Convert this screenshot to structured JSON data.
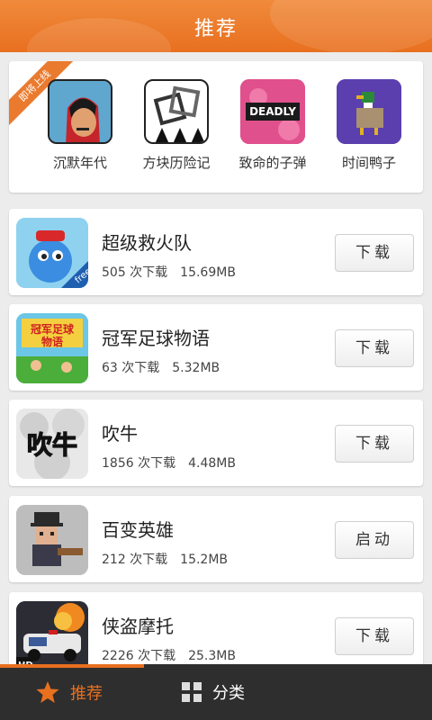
{
  "header": {
    "title": "推荐"
  },
  "featured": {
    "ribbon": "即将上线",
    "items": [
      {
        "label": "沉默年代",
        "icon": "silent-age-icon"
      },
      {
        "label": "方块历险记",
        "icon": "block-adventure-icon"
      },
      {
        "label": "致命的子弹",
        "icon": "deadly-bullet-icon"
      },
      {
        "label": "时间鸭子",
        "icon": "time-duck-icon"
      }
    ]
  },
  "apps": [
    {
      "name": "超级救火队",
      "downloads": "505 次下载",
      "size": "15.69MB",
      "button": "下载",
      "icon": "fire-rescue-icon"
    },
    {
      "name": "冠军足球物语",
      "downloads": "63 次下载",
      "size": "5.32MB",
      "button": "下载",
      "icon": "soccer-story-icon"
    },
    {
      "name": "吹牛",
      "downloads": "1856 次下载",
      "size": "4.48MB",
      "button": "下载",
      "icon": "bluff-icon"
    },
    {
      "name": "百变英雄",
      "downloads": "212 次下载",
      "size": "15.2MB",
      "button": "启动",
      "icon": "hero-icon"
    },
    {
      "name": "侠盗摩托",
      "downloads": "2226 次下载",
      "size": "25.3MB",
      "button": "下载",
      "icon": "moto-icon"
    }
  ],
  "bottom_nav": [
    {
      "label": "推荐",
      "icon": "star-icon",
      "active": true
    },
    {
      "label": "分类",
      "icon": "grid-icon",
      "active": false
    }
  ],
  "colors": {
    "accent": "#e8701f",
    "nav_bg": "#2e2e2e"
  }
}
